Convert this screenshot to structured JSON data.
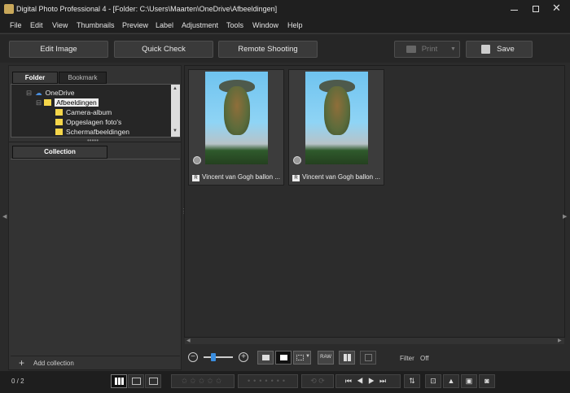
{
  "window": {
    "title": "Digital Photo Professional 4 - [Folder: C:\\Users\\Maarten\\OneDrive\\Afbeeldingen]"
  },
  "menu": [
    "File",
    "Edit",
    "View",
    "Thumbnails",
    "Preview",
    "Label",
    "Adjustment",
    "Tools",
    "Window",
    "Help"
  ],
  "toolbar": {
    "edit_image": "Edit Image",
    "quick_check": "Quick Check",
    "remote_shooting": "Remote Shooting",
    "print": "Print",
    "save": "Save"
  },
  "left": {
    "tabs": {
      "folder": "Folder",
      "bookmark": "Bookmark"
    },
    "tree": {
      "root": "OneDrive",
      "selected": "Afbeeldingen",
      "children": [
        "Camera-album",
        "Opgeslagen foto's",
        "Schermafbeeldingen"
      ]
    },
    "collection_tab": "Collection",
    "add_collection": "Add collection"
  },
  "thumbnails": [
    {
      "caption": "Vincent van Gogh ballon ...",
      "badge": "R"
    },
    {
      "caption": "Vincent van Gogh ballon ...",
      "badge": "R"
    }
  ],
  "bottom": {
    "raw_label": "RAW",
    "filter_label": "Filter",
    "filter_value": "Off"
  },
  "status": {
    "count": "0 / 2"
  }
}
